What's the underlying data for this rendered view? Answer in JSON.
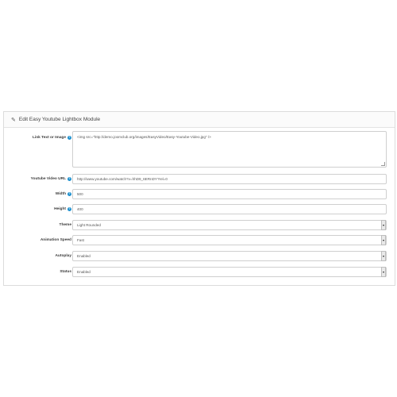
{
  "panel": {
    "title": "Edit Easy Youtube Lightbox Module"
  },
  "icons": {
    "edit": "pencil-icon",
    "help": "question-circle-icon",
    "dropdown": "caret-down-icon"
  },
  "form": {
    "link_text": {
      "label": "Link Text or Image",
      "value": "<img src=\"http://demo.joomclub.org/images/EasyVideo/Easy-Youtube-Video.jpg\" />"
    },
    "youtube_url": {
      "label": "Youtube Video URL",
      "value": "http://www.youtube.com/watch?v=hhD9_6ERnDY?rel=0"
    },
    "width": {
      "label": "Width",
      "value": "500"
    },
    "height": {
      "label": "Height",
      "value": "400"
    },
    "theme": {
      "label": "Theme",
      "value": "Light Rounded"
    },
    "animation_speed": {
      "label": "Animation Speed",
      "value": "Fast"
    },
    "autoplay": {
      "label": "Autoplay",
      "value": "Enabled"
    },
    "status": {
      "label": "Status",
      "value": "Enabled"
    }
  },
  "colors": {
    "help_icon": "#1e91cf",
    "border": "#cfcfcf"
  }
}
